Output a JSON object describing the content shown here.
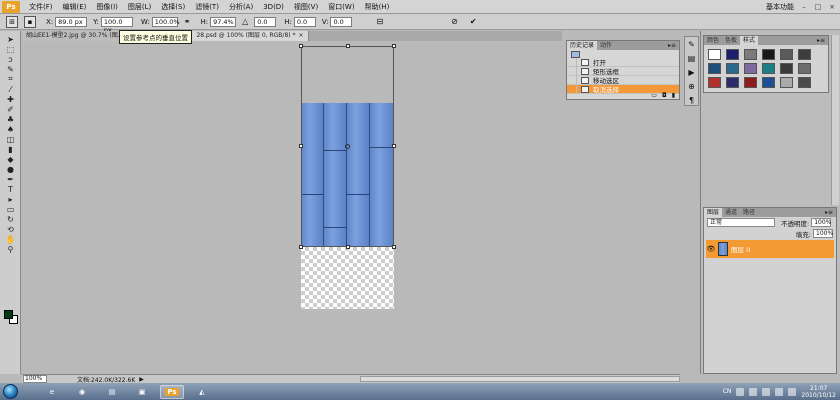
{
  "menubar": {
    "logo": "Ps",
    "items": [
      "文件(F)",
      "编辑(E)",
      "图像(I)",
      "图层(L)",
      "选择(S)",
      "滤镜(T)",
      "分析(A)",
      "3D(D)",
      "视图(V)",
      "窗口(W)",
      "帮助(H)"
    ],
    "workspace": "基本功能",
    "window_buttons": [
      "–",
      "□",
      "×"
    ]
  },
  "options": {
    "x_label": "X:",
    "x_value": "89.0 px",
    "y_label": "Y:",
    "y_value": "100.0 px",
    "w_label": "W:",
    "w_value": "100.0%",
    "h_label": "H:",
    "h_value": "97.4%",
    "angle_value": "0.0",
    "h_skew_label": "H:",
    "h_skew_value": "0.0",
    "v_skew_label": "V:",
    "v_skew_value": "0.0",
    "tooltip": "设置参考点的垂直位置"
  },
  "tabs": {
    "doc1": "胡山EE1-模型2.jpg @ 30.7% (图...",
    "doc2": "28.psd @ 100% (图层 0, RGB/8) *"
  },
  "tools": [
    "move",
    "marquee",
    "lasso",
    "quick-select",
    "crop",
    "eyedropper",
    "healing",
    "brush",
    "clone",
    "history-brush",
    "eraser",
    "gradient",
    "blur",
    "dodge",
    "pen",
    "type",
    "path-select",
    "shape",
    "3d-rotate",
    "3d-orbit",
    "hand",
    "zoom"
  ],
  "status": {
    "zoom": "100%",
    "doc_info": "文档:242.0K/322.6K"
  },
  "history": {
    "tab_active": "历史记录",
    "tab_other": "动作",
    "entries": [
      "打开",
      "矩形选框",
      "移动选区",
      "取消选择"
    ]
  },
  "styles_panel": {
    "tabs": [
      "颜色",
      "色板",
      "样式"
    ],
    "swatches": [
      "#ffffff",
      "#1d1f6e",
      "#7b7b7b",
      "#1a1a1a",
      "#5a5a5a",
      "#3d3d3d",
      "#1e4f7a",
      "#2b6a8f",
      "#7e6a9c",
      "#1c7f86",
      "#3a3a3a",
      "#6c6c6c",
      "#b03030",
      "#2b2b6e",
      "#8f1b1b",
      "#1d4f96",
      "#aaaaaa",
      "#4a4a4a"
    ]
  },
  "layers": {
    "tabs": [
      "图层",
      "通道",
      "路径"
    ],
    "blend_mode": "正常",
    "opacity_label": "不透明度:",
    "opacity_value": "100%",
    "fill_label": "填充:",
    "fill_value": "100%",
    "layer_name": "图层 0"
  },
  "taskbar": {
    "lang": "CN",
    "time": "21:07",
    "date": "2010/10/12",
    "ps_label": "Ps"
  }
}
